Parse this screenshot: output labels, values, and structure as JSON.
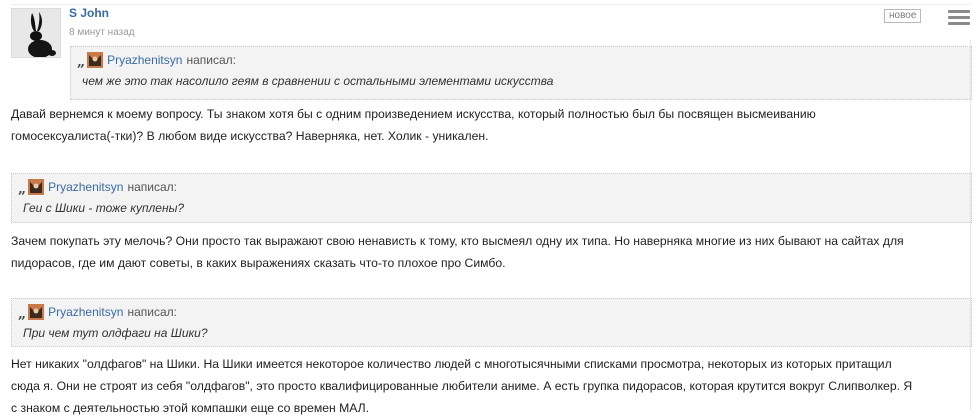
{
  "post": {
    "author": "S John",
    "time": "8 минут назад",
    "badge": "новое"
  },
  "quotes": [
    {
      "name": "Pryazhenitsyn",
      "said": "написал:",
      "text": "чем же это так насолило геям в сравнении с остальными элементами искусства"
    },
    {
      "name": "Pryazhenitsyn",
      "said": "написал:",
      "text": "Геи с Шики - тоже куплены?"
    },
    {
      "name": "Pryazhenitsyn",
      "said": "написал:",
      "text": "При чем тут олдфаги на Шики?"
    }
  ],
  "paragraphs": [
    [
      "Давай вернемся к моему вопросу. Ты знаком хотя бы с одним произведением искусства, который полностью был бы посвящен высмеиванию",
      "гомосексуалиста(-тки)? В любом виде искусства? Наверняка, нет. Холик - уникален."
    ],
    [
      "Зачем покупать эту мелочь? Они просто так выражают свою ненависть к тому, кто высмеял одну их типа. Но наверняка многие из них бывают на сайтах для",
      "пидорасов, где им дают советы, в каких выражениях сказать что-то плохое про Симбо."
    ],
    [
      "Нет никаких \"олдфагов\" на Шики. На Шики имеется некоторое количество людей с многотысячными списками просмотра, некоторых из которых притащил",
      "сюда я. Они не строят из себя \"олдфагов\", это просто квалифицированные любители аниме. А есть групка пидорасов, которая крутится вокруг Слипволкер. Я",
      "с знаком с деятельностью этой компашки еще со времен МАЛ."
    ]
  ],
  "icons": {
    "avatar": "black-rabbit-avatar",
    "quote_marker": "quote-mark-icon",
    "quote_user": "user-avatar-icon",
    "menu": "hamburger-menu-icon"
  },
  "colors": {
    "link": "#3a6ba5",
    "quote_bg": "#f3f3f3",
    "muted": "#9a9a9a"
  }
}
